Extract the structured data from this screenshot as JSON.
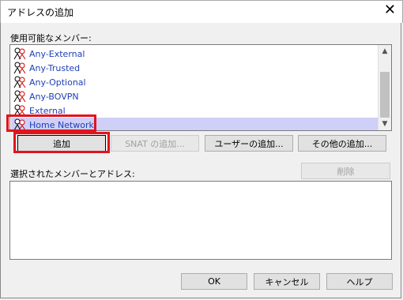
{
  "window": {
    "title": "アドレスの追加",
    "close_glyph": "✕"
  },
  "available": {
    "label": "使用可能なメンバー:",
    "items": [
      {
        "label": "Any-External",
        "icon": "user-group-icon"
      },
      {
        "label": "Any-Trusted",
        "icon": "user-group-icon"
      },
      {
        "label": "Any-Optional",
        "icon": "user-group-icon"
      },
      {
        "label": "Any-BOVPN",
        "icon": "user-group-icon"
      },
      {
        "label": "External",
        "icon": "user-group-icon"
      },
      {
        "label": "Home Network",
        "icon": "user-group-icon",
        "selected": true
      }
    ]
  },
  "buttons": {
    "add": "追加",
    "snat_add": "SNAT の追加...",
    "user_add": "ユーザーの追加...",
    "other_add": "その他の追加...",
    "delete": "削除",
    "ok": "OK",
    "cancel": "キャンセル",
    "help": "ヘルプ"
  },
  "selected": {
    "label": "選択されたメンバーとアドレス:"
  },
  "colors": {
    "highlight": "#e0141e",
    "selection": "#cfcff7",
    "link_text": "#1f3fb5"
  }
}
